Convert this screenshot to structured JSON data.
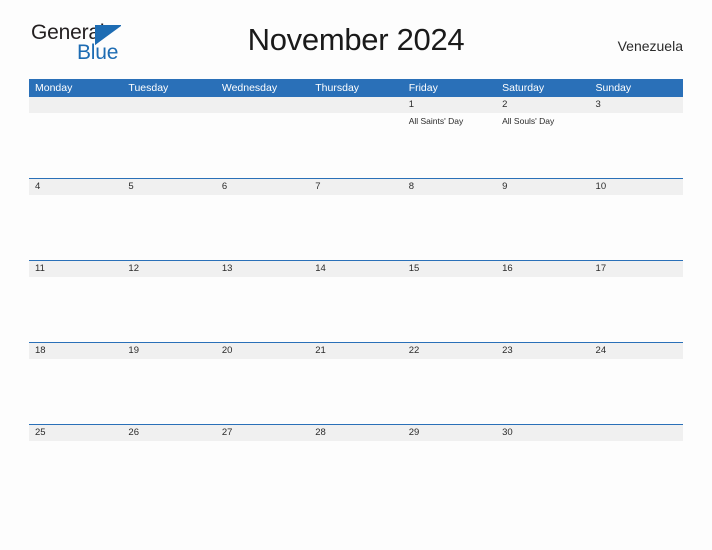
{
  "brand": {
    "word_one": "General",
    "word_two": "Blue",
    "flag_icon": "triangle-flag-icon",
    "color_primary": "#1d6cb3",
    "color_text": "#231f20"
  },
  "header": {
    "title": "November 2024",
    "region": "Venezuela"
  },
  "calendar": {
    "accent_color": "#2a70b8",
    "date_band_color": "#f0f0f0",
    "weekdays": [
      "Monday",
      "Tuesday",
      "Wednesday",
      "Thursday",
      "Friday",
      "Saturday",
      "Sunday"
    ],
    "weeks": [
      {
        "days": [
          {
            "date": "",
            "events": []
          },
          {
            "date": "",
            "events": []
          },
          {
            "date": "",
            "events": []
          },
          {
            "date": "",
            "events": []
          },
          {
            "date": "1",
            "events": [
              "All Saints' Day"
            ]
          },
          {
            "date": "2",
            "events": [
              "All Souls' Day"
            ]
          },
          {
            "date": "3",
            "events": []
          }
        ]
      },
      {
        "days": [
          {
            "date": "4",
            "events": []
          },
          {
            "date": "5",
            "events": []
          },
          {
            "date": "6",
            "events": []
          },
          {
            "date": "7",
            "events": []
          },
          {
            "date": "8",
            "events": []
          },
          {
            "date": "9",
            "events": []
          },
          {
            "date": "10",
            "events": []
          }
        ]
      },
      {
        "days": [
          {
            "date": "11",
            "events": []
          },
          {
            "date": "12",
            "events": []
          },
          {
            "date": "13",
            "events": []
          },
          {
            "date": "14",
            "events": []
          },
          {
            "date": "15",
            "events": []
          },
          {
            "date": "16",
            "events": []
          },
          {
            "date": "17",
            "events": []
          }
        ]
      },
      {
        "days": [
          {
            "date": "18",
            "events": []
          },
          {
            "date": "19",
            "events": []
          },
          {
            "date": "20",
            "events": []
          },
          {
            "date": "21",
            "events": []
          },
          {
            "date": "22",
            "events": []
          },
          {
            "date": "23",
            "events": []
          },
          {
            "date": "24",
            "events": []
          }
        ]
      },
      {
        "days": [
          {
            "date": "25",
            "events": []
          },
          {
            "date": "26",
            "events": []
          },
          {
            "date": "27",
            "events": []
          },
          {
            "date": "28",
            "events": []
          },
          {
            "date": "29",
            "events": []
          },
          {
            "date": "30",
            "events": []
          },
          {
            "date": "",
            "events": []
          }
        ]
      }
    ]
  }
}
